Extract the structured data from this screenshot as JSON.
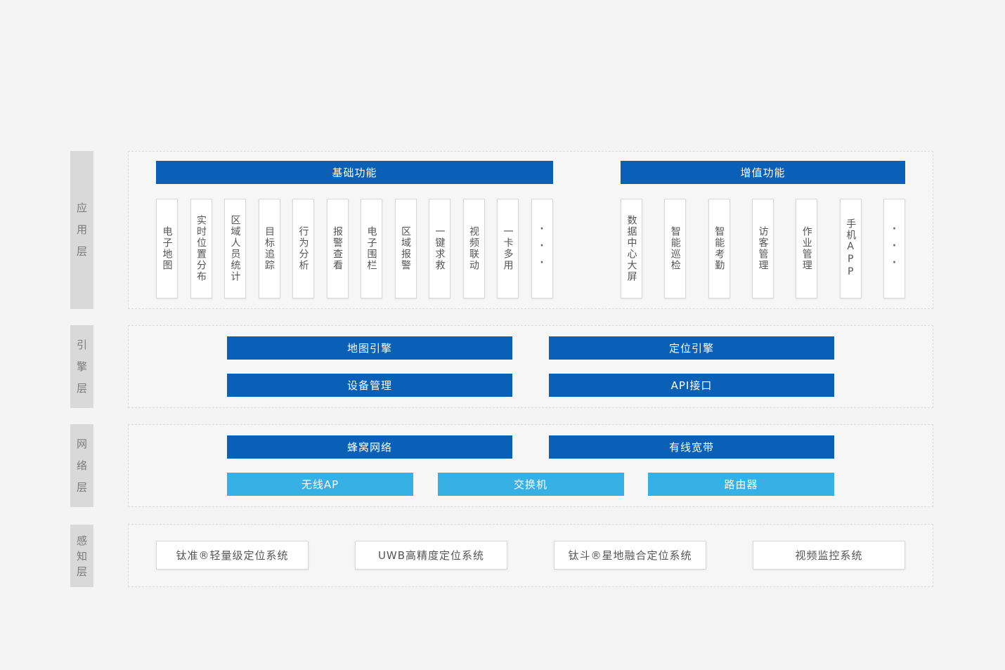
{
  "layers": {
    "application": {
      "label": [
        "应",
        "用",
        "层"
      ]
    },
    "engine": {
      "label": [
        "引",
        "擎",
        "层"
      ]
    },
    "network": {
      "label": [
        "网",
        "络",
        "层"
      ]
    },
    "perception": {
      "label": [
        "感",
        "知",
        "层"
      ]
    }
  },
  "application": {
    "basic_header": "基础功能",
    "value_added_header": "增值功能",
    "basic_items": [
      "电子地图",
      "实时位置分布",
      "区域人员统计",
      "目标追踪",
      "行为分析",
      "报警查看",
      "电子围栏",
      "区域报警",
      "一键求救",
      "视频联动",
      "一卡多用",
      "···"
    ],
    "value_added_items": [
      "数据中心大屏",
      "智能巡检",
      "智能考勤",
      "访客管理",
      "作业管理",
      "手机APP",
      "···"
    ]
  },
  "engine": {
    "map_engine": "地图引擎",
    "positioning_engine": "定位引擎",
    "device_management": "设备管理",
    "api_interface": "API接口"
  },
  "network": {
    "cellular": "蜂窝网络",
    "wired_broadband": "有线宽带",
    "wireless_ap": "无线AP",
    "switch": "交换机",
    "router": "路由器"
  },
  "perception": {
    "items": [
      "钛准®轻量级定位系统",
      "UWB高精度定位系统",
      "钛斗®星地融合定位系统",
      "视频监控系统"
    ]
  },
  "colors": {
    "primary_blue": "#0a60b6",
    "light_blue": "#37b0e6",
    "label_gray": "#d9d9d9",
    "background": "#f4f4f4"
  }
}
